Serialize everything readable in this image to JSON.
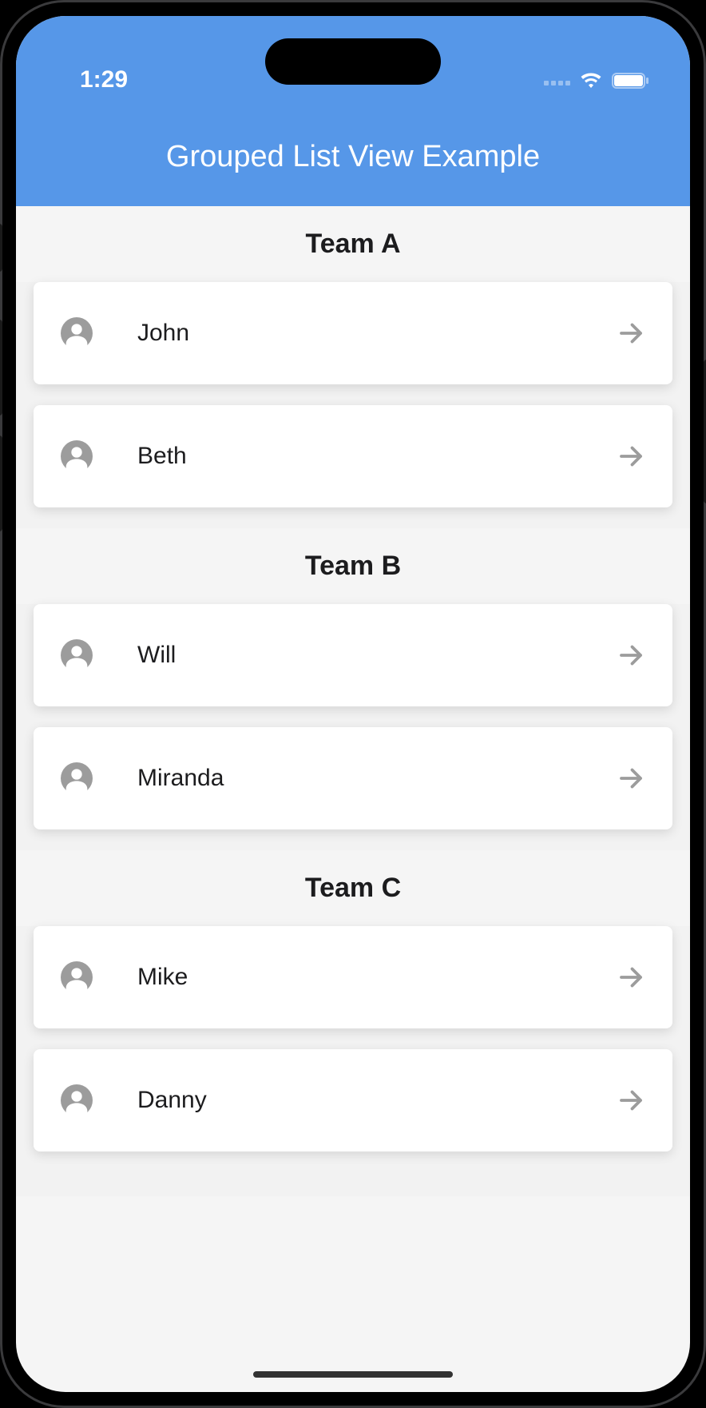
{
  "status": {
    "time": "1:29"
  },
  "header": {
    "title": "Grouped List View Example"
  },
  "groups": [
    {
      "title": "Team A",
      "items": [
        {
          "name": "John"
        },
        {
          "name": "Beth"
        }
      ]
    },
    {
      "title": "Team B",
      "items": [
        {
          "name": "Will"
        },
        {
          "name": "Miranda"
        }
      ]
    },
    {
      "title": "Team C",
      "items": [
        {
          "name": "Mike"
        },
        {
          "name": "Danny"
        }
      ]
    }
  ],
  "colors": {
    "accent": "#5697e8",
    "background": "#f2f2f2",
    "card": "#ffffff",
    "iconGray": "#9c9c9c"
  }
}
